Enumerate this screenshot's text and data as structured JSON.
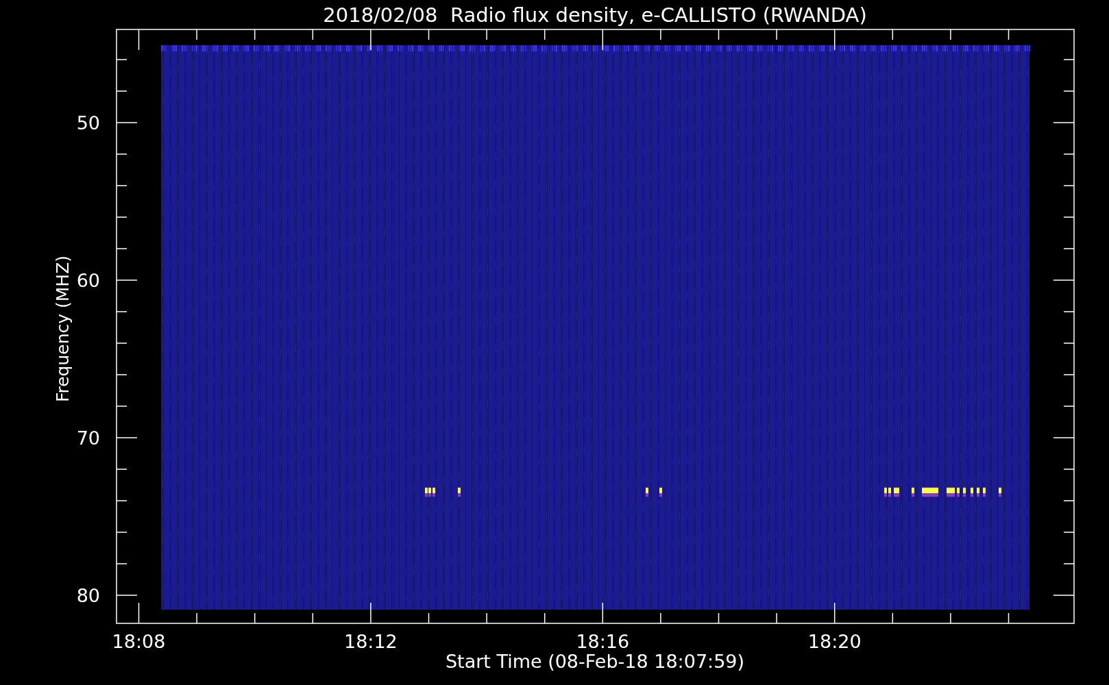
{
  "title": "2018/02/08  Radio flux density, e-CALLISTO (RWANDA)",
  "y_axis": {
    "label": "Frequency (MHZ)",
    "ticks": [
      "50",
      "60",
      "70",
      "80"
    ]
  },
  "x_axis": {
    "label": "Start Time (08-Feb-18 18:07:59)",
    "ticks": [
      "18:08",
      "18:12",
      "18:16",
      "18:20"
    ]
  }
}
